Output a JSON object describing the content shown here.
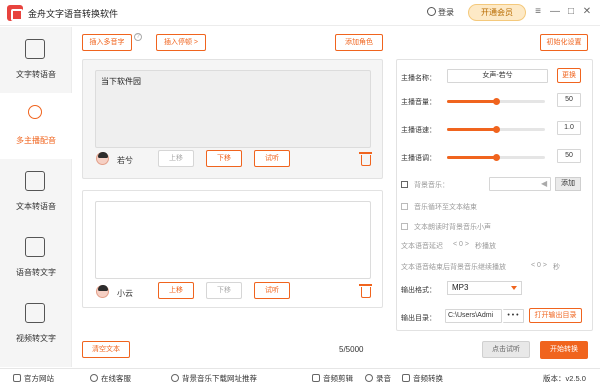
{
  "app": {
    "title": "金舟文字语音转换软件",
    "login": "登录",
    "vip": "开通会员"
  },
  "sidebar": {
    "items": [
      {
        "label": "文字转语音",
        "icon": "text-to-speech-icon"
      },
      {
        "label": "多主播配音",
        "icon": "multi-anchor-icon"
      },
      {
        "label": "文本转语音",
        "icon": "document-to-speech-icon"
      },
      {
        "label": "语音转文字",
        "icon": "speech-to-text-icon"
      },
      {
        "label": "视频转文字",
        "icon": "video-to-text-icon"
      }
    ]
  },
  "toolbar": {
    "insert_polyphone": "插入多音字",
    "insert_pause": "插入停顿 >",
    "add_role": "添加角色",
    "init_settings": "初始化设置"
  },
  "roles": [
    {
      "text": "当下软件园",
      "name": "若兮",
      "up": "上移",
      "down": "下移",
      "listen": "试听"
    },
    {
      "text": "",
      "name": "小云",
      "up": "上移",
      "down": "下移",
      "listen": "试听"
    }
  ],
  "bottom": {
    "clear_text": "清空文本",
    "counter": "5/5000",
    "listen_all": "点击试听",
    "start": "开始转换"
  },
  "settings": {
    "anchor_name_label": "主播名称：",
    "anchor_name": "女声-若兮",
    "change": "更换",
    "volume_label": "主播音量：",
    "volume": "50",
    "volume_pct": 50,
    "speed_label": "主播语速：",
    "speed": "1.0",
    "speed_pct": 50,
    "pitch_label": "主播语调：",
    "pitch": "50",
    "pitch_pct": 50,
    "bgm_label": "背景音乐：",
    "bgm_add": "添加",
    "loop_label": "音乐循环至文本结束",
    "lower_label": "文本朗读时背景音乐小声",
    "delay_label": "文本语音延迟",
    "delay_value": "< 0 >",
    "delay_unit": "秒播放",
    "continue_label": "文本语音结束后背景音乐继续播放",
    "continue_value": "< 0 >",
    "continue_unit": "秒",
    "format_label": "输出格式：",
    "format": "MP3",
    "dir_label": "输出目录：",
    "dir": "C:\\Users\\Admi",
    "dir_more": "• • •",
    "open_dir": "打开输出目录"
  },
  "footer": {
    "website": "官方网站",
    "service": "在线客服",
    "bgm_download": "背景音乐下载网址推荐",
    "audio_edit": "音频剪辑",
    "record": "录音",
    "audio_convert": "音频转换",
    "version": "版本：v2.5.0"
  },
  "colors": {
    "accent": "#f0641e",
    "vip_bg": "#fde9c6"
  }
}
